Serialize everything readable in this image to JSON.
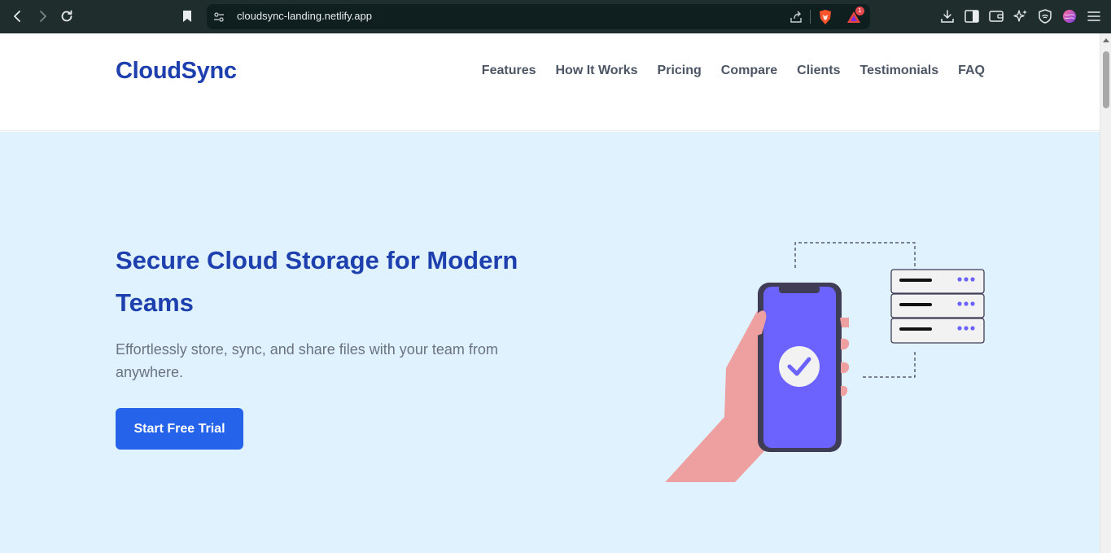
{
  "browser": {
    "url": "cloudsync-landing.netlify.app",
    "notification_count": "1"
  },
  "header": {
    "logo": "CloudSync",
    "nav": [
      {
        "label": "Features"
      },
      {
        "label": "How It Works"
      },
      {
        "label": "Pricing"
      },
      {
        "label": "Compare"
      },
      {
        "label": "Clients"
      },
      {
        "label": "Testimonials"
      },
      {
        "label": "FAQ"
      }
    ]
  },
  "hero": {
    "title": "Secure Cloud Storage for Modern Teams",
    "subtitle": "Effortlessly store, sync, and share files with your team from anywhere.",
    "cta_label": "Start Free Trial"
  },
  "colors": {
    "brand": "#1e40af",
    "accent": "#2563eb",
    "hero_bg": "#e0f2fe",
    "phone_screen": "#6c63ff",
    "hand": "#ee9f9f"
  },
  "icons": {
    "back": "arrow-left-icon",
    "forward": "arrow-right-icon",
    "reload": "reload-icon",
    "bookmark": "bookmark-icon",
    "site_settings": "tune-icon",
    "share": "share-icon",
    "brave_shield": "lion-shield-icon",
    "rewards": "triangle-rewards-icon",
    "download": "download-icon",
    "sidebar": "sidebar-icon",
    "wallet": "wallet-icon",
    "leo": "sparkle-icon",
    "vpn": "vpn-icon",
    "profile": "profile-avatar-icon",
    "menu": "hamburger-menu-icon"
  }
}
